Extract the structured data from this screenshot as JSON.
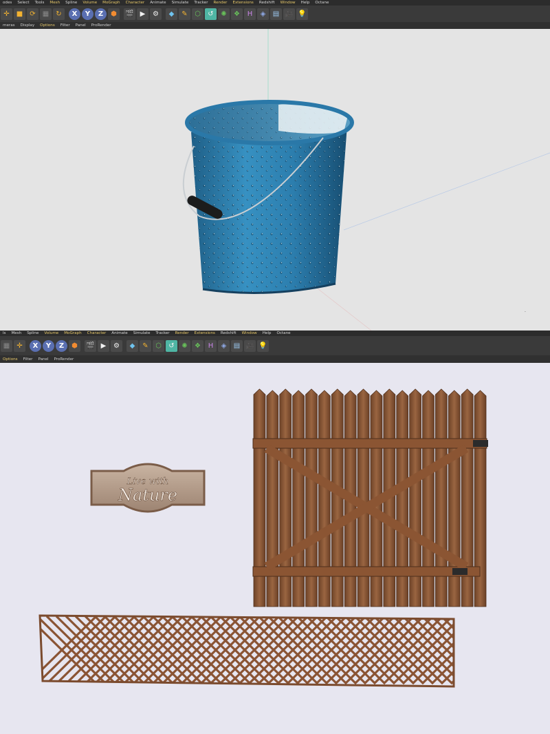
{
  "top_window": {
    "menu": [
      "odes",
      "Select",
      "Tools",
      "Mesh",
      "Spline",
      "Volume",
      "MoGraph",
      "Character",
      "Animate",
      "Simulate",
      "Tracker",
      "Render",
      "Extensions",
      "Redshift",
      "Window",
      "Help",
      "Octane"
    ],
    "highlighted_menu": [
      "Mesh",
      "Volume",
      "MoGraph",
      "Character",
      "Render",
      "Extensions",
      "Window"
    ],
    "toolbar_axis": [
      "X",
      "Y",
      "Z"
    ],
    "submenu": [
      "meras",
      "Display",
      "Options",
      "Filter",
      "Panel",
      "ProRender"
    ],
    "highlighted_submenu": [
      "Options"
    ]
  },
  "bottom_window": {
    "menu": [
      "ls",
      "Mesh",
      "Spline",
      "Volume",
      "MoGraph",
      "Character",
      "Animate",
      "Simulate",
      "Tracker",
      "Render",
      "Extensions",
      "Redshift",
      "Window",
      "Help",
      "Octane"
    ],
    "highlighted_menu": [
      "Volume",
      "MoGraph",
      "Character",
      "Render",
      "Extensions",
      "Window"
    ],
    "toolbar_axis": [
      "X",
      "Y",
      "Z"
    ],
    "submenu": [
      "Options",
      "Filter",
      "Panel",
      "ProRender"
    ],
    "highlighted_submenu": [
      "Options"
    ]
  },
  "scene_top": {
    "objects": [
      "bucket"
    ],
    "colors": {
      "bucket": "#2f7fae",
      "viewport_bg": "#e4e4e4"
    }
  },
  "scene_bottom": {
    "objects": [
      "wooden sign",
      "wooden gate",
      "lattice panel"
    ],
    "sign_text": {
      "line1": "Live with",
      "line2": "Nature"
    },
    "colors": {
      "wood": "#8a5a3a",
      "viewport_bg": "#e7e6f0"
    }
  }
}
